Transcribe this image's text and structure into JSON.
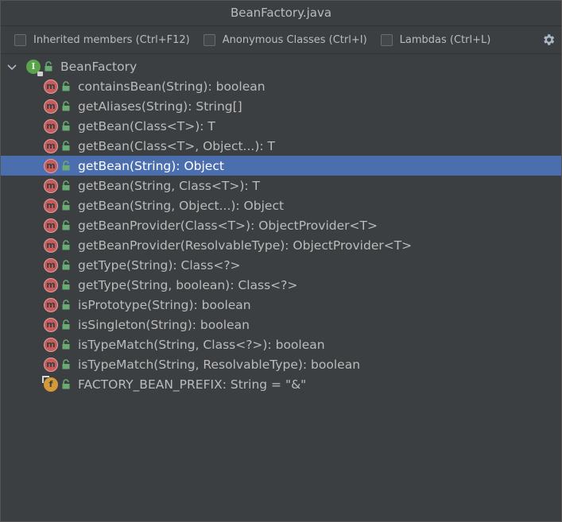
{
  "window": {
    "title": "BeanFactory.java"
  },
  "toolbar": {
    "options": [
      {
        "label": "Inherited members (Ctrl+F12)",
        "checked": false
      },
      {
        "label": "Anonymous Classes (Ctrl+I)",
        "checked": false
      },
      {
        "label": "Lambdas (Ctrl+L)",
        "checked": false
      }
    ],
    "settings_icon": "gear-icon"
  },
  "tree": {
    "root": {
      "label": "BeanFactory",
      "icon": "interface-icon",
      "icon_letter": "I",
      "expanded": true
    },
    "items": [
      {
        "label": "containsBean(String): boolean",
        "kind": "method",
        "icon_letter": "m"
      },
      {
        "label": "getAliases(String): String[]",
        "kind": "method",
        "icon_letter": "m"
      },
      {
        "label": "getBean(Class<T>): T",
        "kind": "method",
        "icon_letter": "m"
      },
      {
        "label": "getBean(Class<T>, Object...): T",
        "kind": "method",
        "icon_letter": "m"
      },
      {
        "label": "getBean(String): Object",
        "kind": "method",
        "icon_letter": "m",
        "selected": true
      },
      {
        "label": "getBean(String, Class<T>): T",
        "kind": "method",
        "icon_letter": "m"
      },
      {
        "label": "getBean(String, Object...): Object",
        "kind": "method",
        "icon_letter": "m"
      },
      {
        "label": "getBeanProvider(Class<T>): ObjectProvider<T>",
        "kind": "method",
        "icon_letter": "m"
      },
      {
        "label": "getBeanProvider(ResolvableType): ObjectProvider<T>",
        "kind": "method",
        "icon_letter": "m"
      },
      {
        "label": "getType(String): Class<?>",
        "kind": "method",
        "icon_letter": "m"
      },
      {
        "label": "getType(String, boolean): Class<?>",
        "kind": "method",
        "icon_letter": "m"
      },
      {
        "label": "isPrototype(String): boolean",
        "kind": "method",
        "icon_letter": "m"
      },
      {
        "label": "isSingleton(String): boolean",
        "kind": "method",
        "icon_letter": "m"
      },
      {
        "label": "isTypeMatch(String, Class<?>): boolean",
        "kind": "method",
        "icon_letter": "m"
      },
      {
        "label": "isTypeMatch(String, ResolvableType): boolean",
        "kind": "method",
        "icon_letter": "m"
      },
      {
        "label": "FACTORY_BEAN_PREFIX: String = \"&\"",
        "kind": "field",
        "icon_letter": "f"
      }
    ]
  },
  "colors": {
    "background": "#3c3f41",
    "selection": "#4b6eaf",
    "method_icon": "#c75c5c",
    "field_icon": "#d49a3a",
    "interface_icon": "#59a34a",
    "public_lock": "#6aab73"
  }
}
